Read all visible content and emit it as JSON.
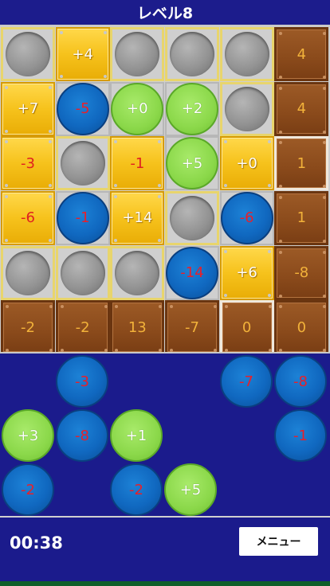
{
  "title": "レベル8",
  "board": {
    "rows": [
      [
        {
          "t": "slot",
          "hl": true
        },
        {
          "t": "gold",
          "v": "+4"
        },
        {
          "t": "slot",
          "hl": true
        },
        {
          "t": "slot",
          "hl": true
        },
        {
          "t": "slot",
          "hl": true
        },
        {
          "t": "brown",
          "v": "4"
        }
      ],
      [
        {
          "t": "gold",
          "v": "+7"
        },
        {
          "t": "blue",
          "v": "-5"
        },
        {
          "t": "green",
          "v": "+0"
        },
        {
          "t": "green",
          "v": "+2"
        },
        {
          "t": "slot",
          "hl": true
        },
        {
          "t": "brown",
          "v": "4"
        }
      ],
      [
        {
          "t": "gold",
          "v": "-3"
        },
        {
          "t": "slot",
          "hl": true
        },
        {
          "t": "gold",
          "v": "-1"
        },
        {
          "t": "green",
          "v": "+5"
        },
        {
          "t": "gold",
          "v": "+0"
        },
        {
          "t": "brown",
          "v": "1",
          "hl": true
        }
      ],
      [
        {
          "t": "gold",
          "v": "-6"
        },
        {
          "t": "blue",
          "v": "-1"
        },
        {
          "t": "gold",
          "v": "+14"
        },
        {
          "t": "slot",
          "hl": true
        },
        {
          "t": "blue",
          "v": "-6"
        },
        {
          "t": "brown",
          "v": "1"
        }
      ],
      [
        {
          "t": "slot",
          "hl": true
        },
        {
          "t": "slot",
          "hl": true
        },
        {
          "t": "slot",
          "hl": true
        },
        {
          "t": "blue",
          "v": "-14"
        },
        {
          "t": "gold",
          "v": "+6"
        },
        {
          "t": "brown",
          "v": "-8"
        }
      ],
      [
        {
          "t": "brown",
          "v": "-2"
        },
        {
          "t": "brown",
          "v": "-2"
        },
        {
          "t": "brown",
          "v": "13"
        },
        {
          "t": "brown",
          "v": "-7"
        },
        {
          "t": "brown",
          "v": "0",
          "hl": true
        },
        {
          "t": "brown",
          "v": "0"
        }
      ]
    ]
  },
  "tray": {
    "rows": [
      [
        null,
        {
          "t": "blue",
          "v": "-3"
        },
        null,
        null,
        {
          "t": "blue",
          "v": "-7"
        },
        {
          "t": "blue",
          "v": "-8"
        }
      ],
      [
        {
          "t": "green",
          "v": "+3"
        },
        {
          "t": "blue",
          "v": "-8"
        },
        {
          "t": "green",
          "v": "+1"
        },
        null,
        null,
        {
          "t": "blue",
          "v": "-1"
        }
      ],
      [
        {
          "t": "blue",
          "v": "-2"
        },
        null,
        {
          "t": "blue",
          "v": "-2"
        },
        {
          "t": "green",
          "v": "+5"
        },
        null,
        null
      ]
    ]
  },
  "footer": {
    "timer": "00:38",
    "menu_label": "メニュー"
  },
  "colors": {
    "background": "#1b1b8c",
    "gold": "#f6c21c",
    "brown": "#8a4a1b",
    "blue_piece": "#1068c0",
    "green_piece": "#8bd84a",
    "negative_text": "#e02020"
  }
}
